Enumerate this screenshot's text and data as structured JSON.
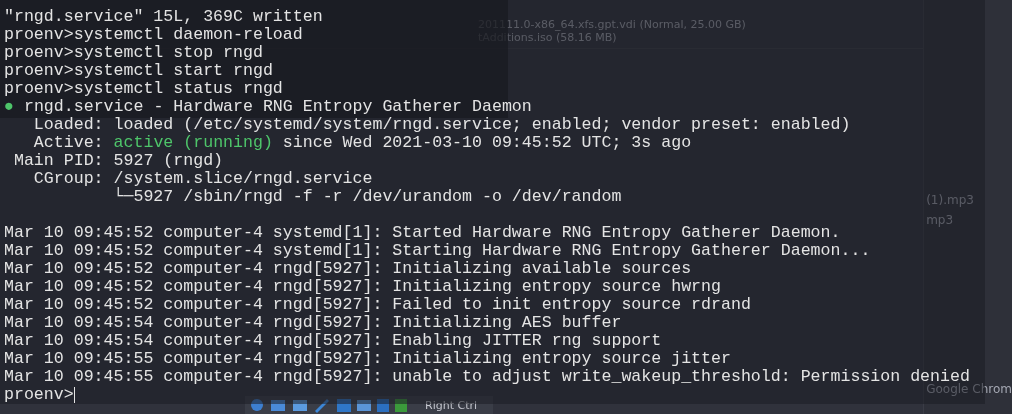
{
  "background_window": {
    "file_lines": [
      "201111.0-x86_64.xfs.gpt.vdi (Normal, 25.00 GB)",
      "tAdditions.iso (58.16 MB)"
    ],
    "side_items": [
      "(1).mp3",
      "mp3"
    ],
    "taskbar_label": "Google Chrom",
    "host_key": "Right Ctrl"
  },
  "terminal": {
    "lines": [
      {
        "kind": "plain",
        "text": "\"rngd.service\" 15L, 369C written"
      },
      {
        "kind": "plain",
        "text": "proenv>systemctl daemon-reload"
      },
      {
        "kind": "plain",
        "text": "proenv>systemctl stop rngd"
      },
      {
        "kind": "plain",
        "text": "proenv>systemctl start rngd"
      },
      {
        "kind": "plain",
        "text": "proenv>systemctl status rngd"
      },
      {
        "kind": "status",
        "bullet": "●",
        "text": " rngd.service - Hardware RNG Entropy Gatherer Daemon"
      },
      {
        "kind": "plain",
        "text": "   Loaded: loaded (/etc/systemd/system/rngd.service; enabled; vendor preset: enabled)"
      },
      {
        "kind": "active",
        "prefix": "   Active: ",
        "highlight": "active (running)",
        "suffix": " since Wed 2021-03-10 09:45:52 UTC; 3s ago"
      },
      {
        "kind": "plain",
        "text": " Main PID: 5927 (rngd)"
      },
      {
        "kind": "plain",
        "text": "   CGroup: /system.slice/rngd.service"
      },
      {
        "kind": "plain",
        "text": "           └─5927 /sbin/rngd -f -r /dev/urandom -o /dev/random"
      },
      {
        "kind": "blank"
      },
      {
        "kind": "plain",
        "text": "Mar 10 09:45:52 computer-4 systemd[1]: Started Hardware RNG Entropy Gatherer Daemon."
      },
      {
        "kind": "plain",
        "text": "Mar 10 09:45:52 computer-4 systemd[1]: Starting Hardware RNG Entropy Gatherer Daemon..."
      },
      {
        "kind": "plain",
        "text": "Mar 10 09:45:52 computer-4 rngd[5927]: Initializing available sources"
      },
      {
        "kind": "plain",
        "text": "Mar 10 09:45:52 computer-4 rngd[5927]: Initializing entropy source hwrng"
      },
      {
        "kind": "plain",
        "text": "Mar 10 09:45:52 computer-4 rngd[5927]: Failed to init entropy source rdrand"
      },
      {
        "kind": "plain",
        "text": "Mar 10 09:45:54 computer-4 rngd[5927]: Initializing AES buffer"
      },
      {
        "kind": "plain",
        "text": "Mar 10 09:45:54 computer-4 rngd[5927]: Enabling JITTER rng support"
      },
      {
        "kind": "plain",
        "text": "Mar 10 09:45:55 computer-4 rngd[5927]: Initializing entropy source jitter"
      },
      {
        "kind": "plain",
        "text": "Mar 10 09:45:55 computer-4 rngd[5927]: unable to adjust write_wakeup_threshold: Permission denied"
      }
    ],
    "prompt": "proenv>"
  }
}
